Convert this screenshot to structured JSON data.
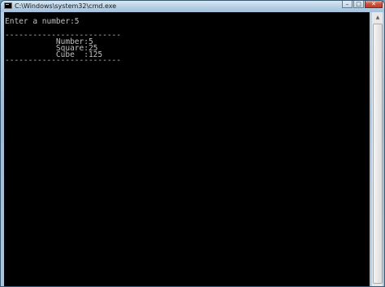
{
  "window": {
    "title": "C:\\Windows\\system32\\cmd.exe",
    "controls": {
      "minimize": "–",
      "maximize": "□",
      "close": "✕"
    }
  },
  "console": {
    "lines": [
      "Enter a number:5",
      "-------------------------",
      "           Number:5",
      "           Square:25",
      "           Cube  :125",
      "-------------------------"
    ]
  },
  "scrollbar": {
    "up_arrow": "▲"
  },
  "colors": {
    "console_bg": "#000000",
    "console_fg": "#c0c0c0",
    "titlebar": "#b6cfe4"
  }
}
